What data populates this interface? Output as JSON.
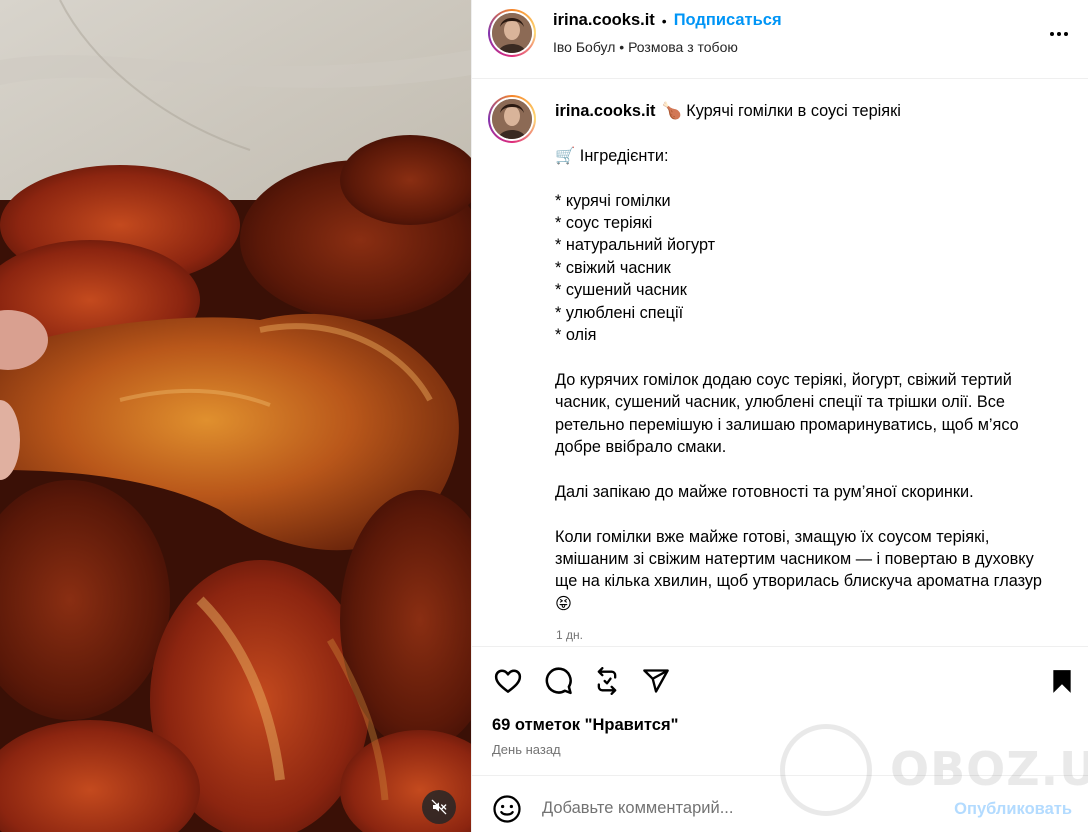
{
  "colors": {
    "accent": "#0095f6",
    "publish_disabled": "#b3dbff",
    "secondary_text": "#737373"
  },
  "post": {
    "author": "irina.cooks.it",
    "follow_label": "Подписаться",
    "separator": "•",
    "subtitle": "Іво Бобул • Розмова з тобою"
  },
  "caption": {
    "username": "irina.cooks.it",
    "title": "🍗 Курячі гомілки в соусі теріякі",
    "ingredients_heading": "🛒 Інгредієнти:",
    "ingredients": [
      "* курячі гомілки",
      "* соус теріякі",
      "* натуральний йогурт",
      "* свіжий часник",
      "* сушений часник",
      "* улюблені спеції",
      "* олія"
    ],
    "paragraph1": "До курячих гомілок додаю соус теріякі, йогурт, свіжий тертий часник, сушений часник, улюблені спеції та трішки олії. Все ретельно перемішую і залишаю промаринуватись, щоб м’ясо добре ввібрало смаки.",
    "paragraph2": "Далі запікаю до майже готовності та рум’яної скоринки.",
    "paragraph3": "Коли гомілки вже майже готові, змащую їх соусом теріякі, змішаним зі свіжим натертим часником — і повертаю в духовку ще на кілька хвилин, щоб утворилась блискуча ароматна глазур 😝",
    "timestamp": "1 дн."
  },
  "actions": {
    "like_icon": "heart-icon",
    "comment_icon": "comment-icon",
    "repost_icon": "repost-icon",
    "share_icon": "share-icon",
    "save_icon": "bookmark-icon"
  },
  "likes_text": "69 отметок \"Нравится\"",
  "posted_ago": "День назад",
  "comment": {
    "placeholder": "Добавьте комментарий...",
    "publish_label": "Опубликовать"
  },
  "media": {
    "mute_icon": "muted-speaker-icon"
  },
  "watermark": {
    "text": "OBOZ.UA"
  }
}
